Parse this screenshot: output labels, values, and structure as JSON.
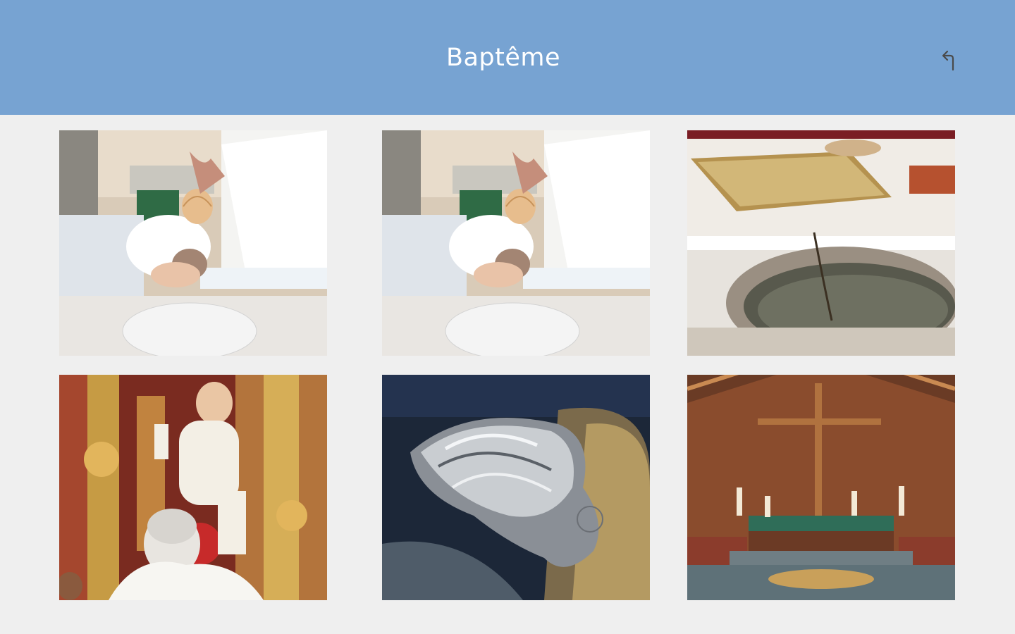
{
  "header": {
    "title": "Baptême",
    "background_color": "#77a3d2",
    "back_icon": "return-arrow-icon"
  },
  "gallery": {
    "tiles": [
      {
        "subject": "baby-baptism-shell-pouring-photo"
      },
      {
        "subject": "baby-baptism-shell-pouring-photo"
      },
      {
        "subject": "bible-and-baptismal-font-photo"
      },
      {
        "subject": "priest-lifting-baby-photo"
      },
      {
        "subject": "silver-baptismal-shell-photo"
      },
      {
        "subject": "church-altar-cross-photo"
      }
    ]
  }
}
